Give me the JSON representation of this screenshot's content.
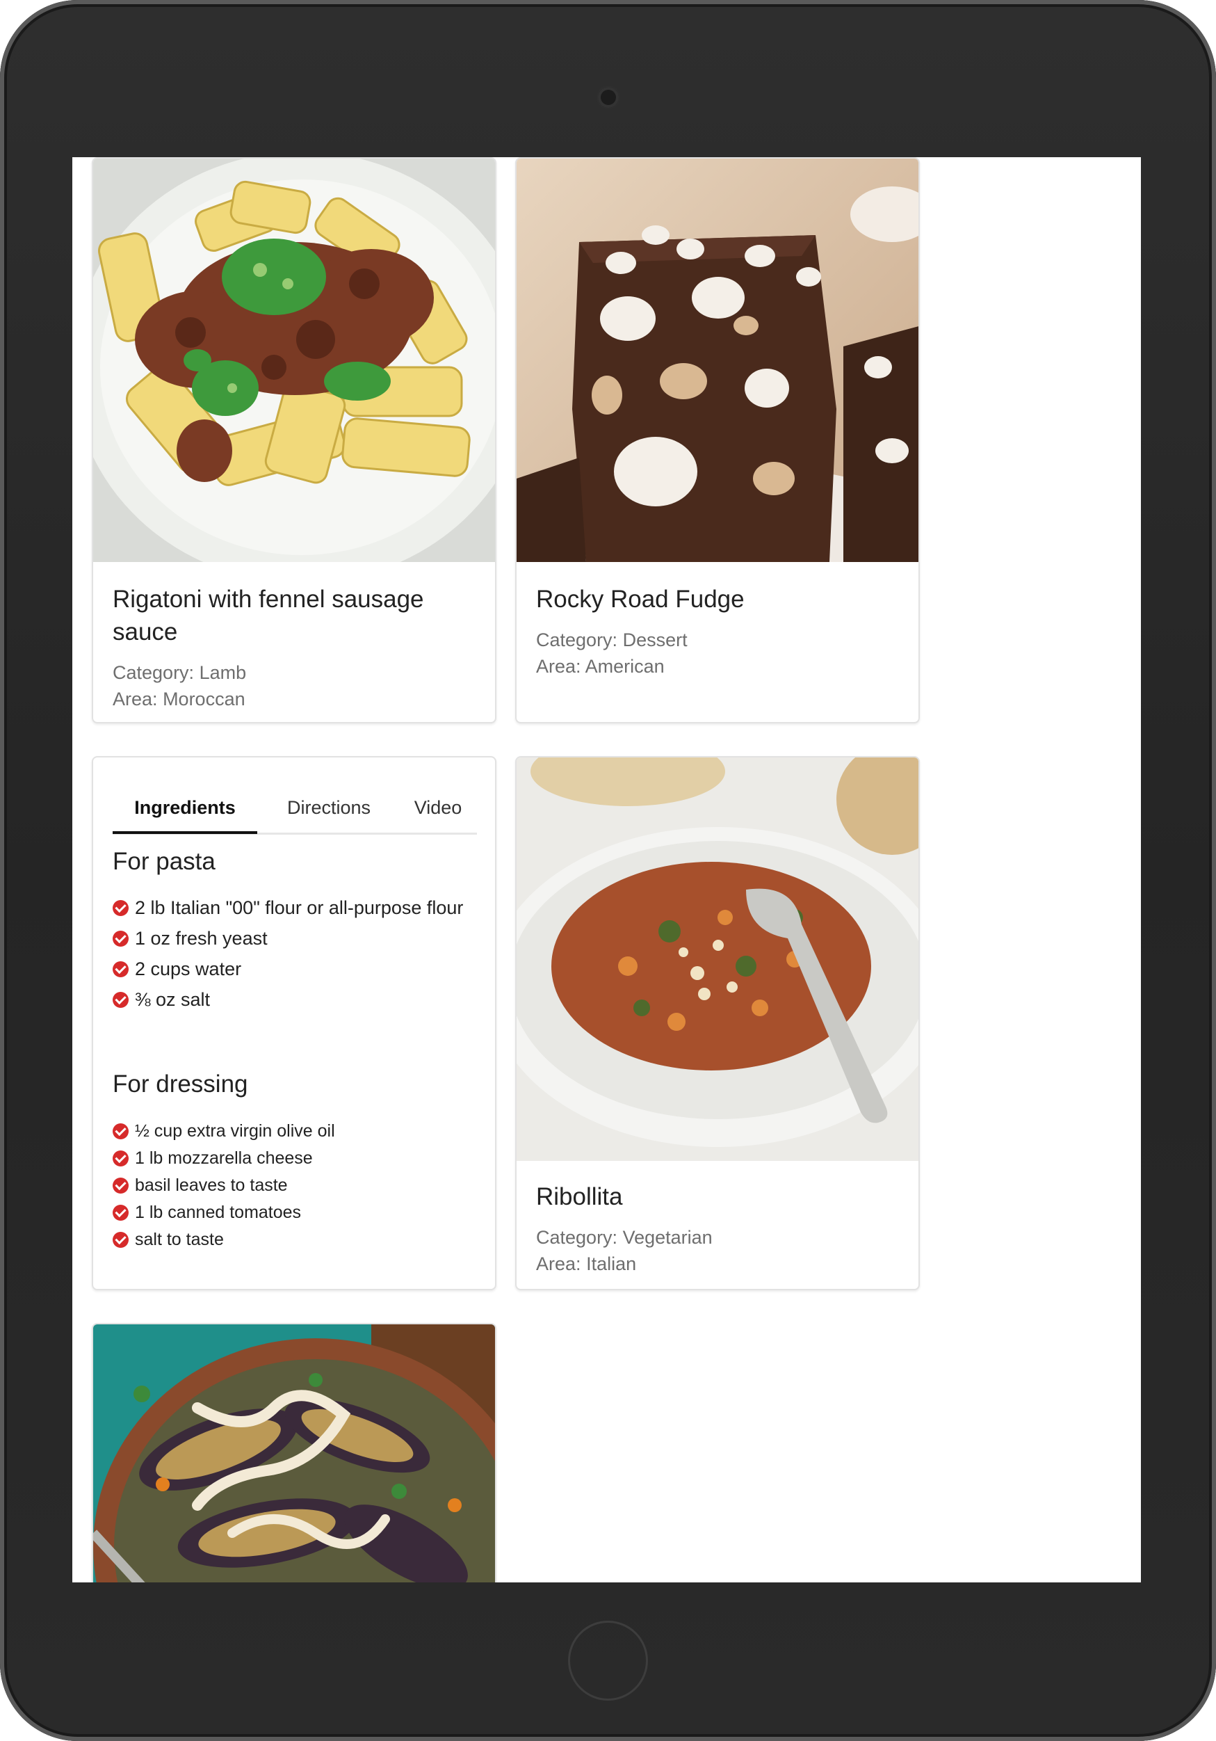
{
  "recipes": [
    {
      "title": "Rigatoni with fennel sausage sauce",
      "category_label": "Category:",
      "category": "Lamb",
      "area_label": "Area:",
      "area": "Moroccan",
      "image": "rigatoni-pasta-photo"
    },
    {
      "title": "Rocky Road Fudge",
      "category_label": "Category:",
      "category": "Dessert",
      "area_label": "Area:",
      "area": "American",
      "image": "rocky-road-fudge-photo"
    },
    {
      "title": "Ribollita",
      "category_label": "Category:",
      "category": "Vegetarian",
      "area_label": "Area:",
      "area": "Italian",
      "image": "ribollita-soup-photo"
    },
    {
      "image": "eggplant-lentil-dish-photo"
    }
  ],
  "detail": {
    "tabs": [
      "Ingredients",
      "Directions",
      "Video"
    ],
    "active_tab": "Ingredients",
    "sections": [
      {
        "heading": "For pasta",
        "items": [
          "2 lb Italian \"00\" flour or all-purpose flour",
          "1 oz fresh yeast",
          "2 cups water",
          "⅜ oz salt"
        ]
      },
      {
        "heading": "For dressing",
        "items": [
          "½ cup extra virgin olive oil",
          "1 lb mozzarella cheese",
          "basil leaves to taste",
          "1 lb canned tomatoes",
          "salt to taste"
        ]
      }
    ]
  },
  "colors": {
    "check": "#d62a2a",
    "device_frame": "#2a2a2a",
    "card_border": "#e2e2e2"
  },
  "icons": {
    "ingredient_bullet": "check-circle-icon"
  }
}
